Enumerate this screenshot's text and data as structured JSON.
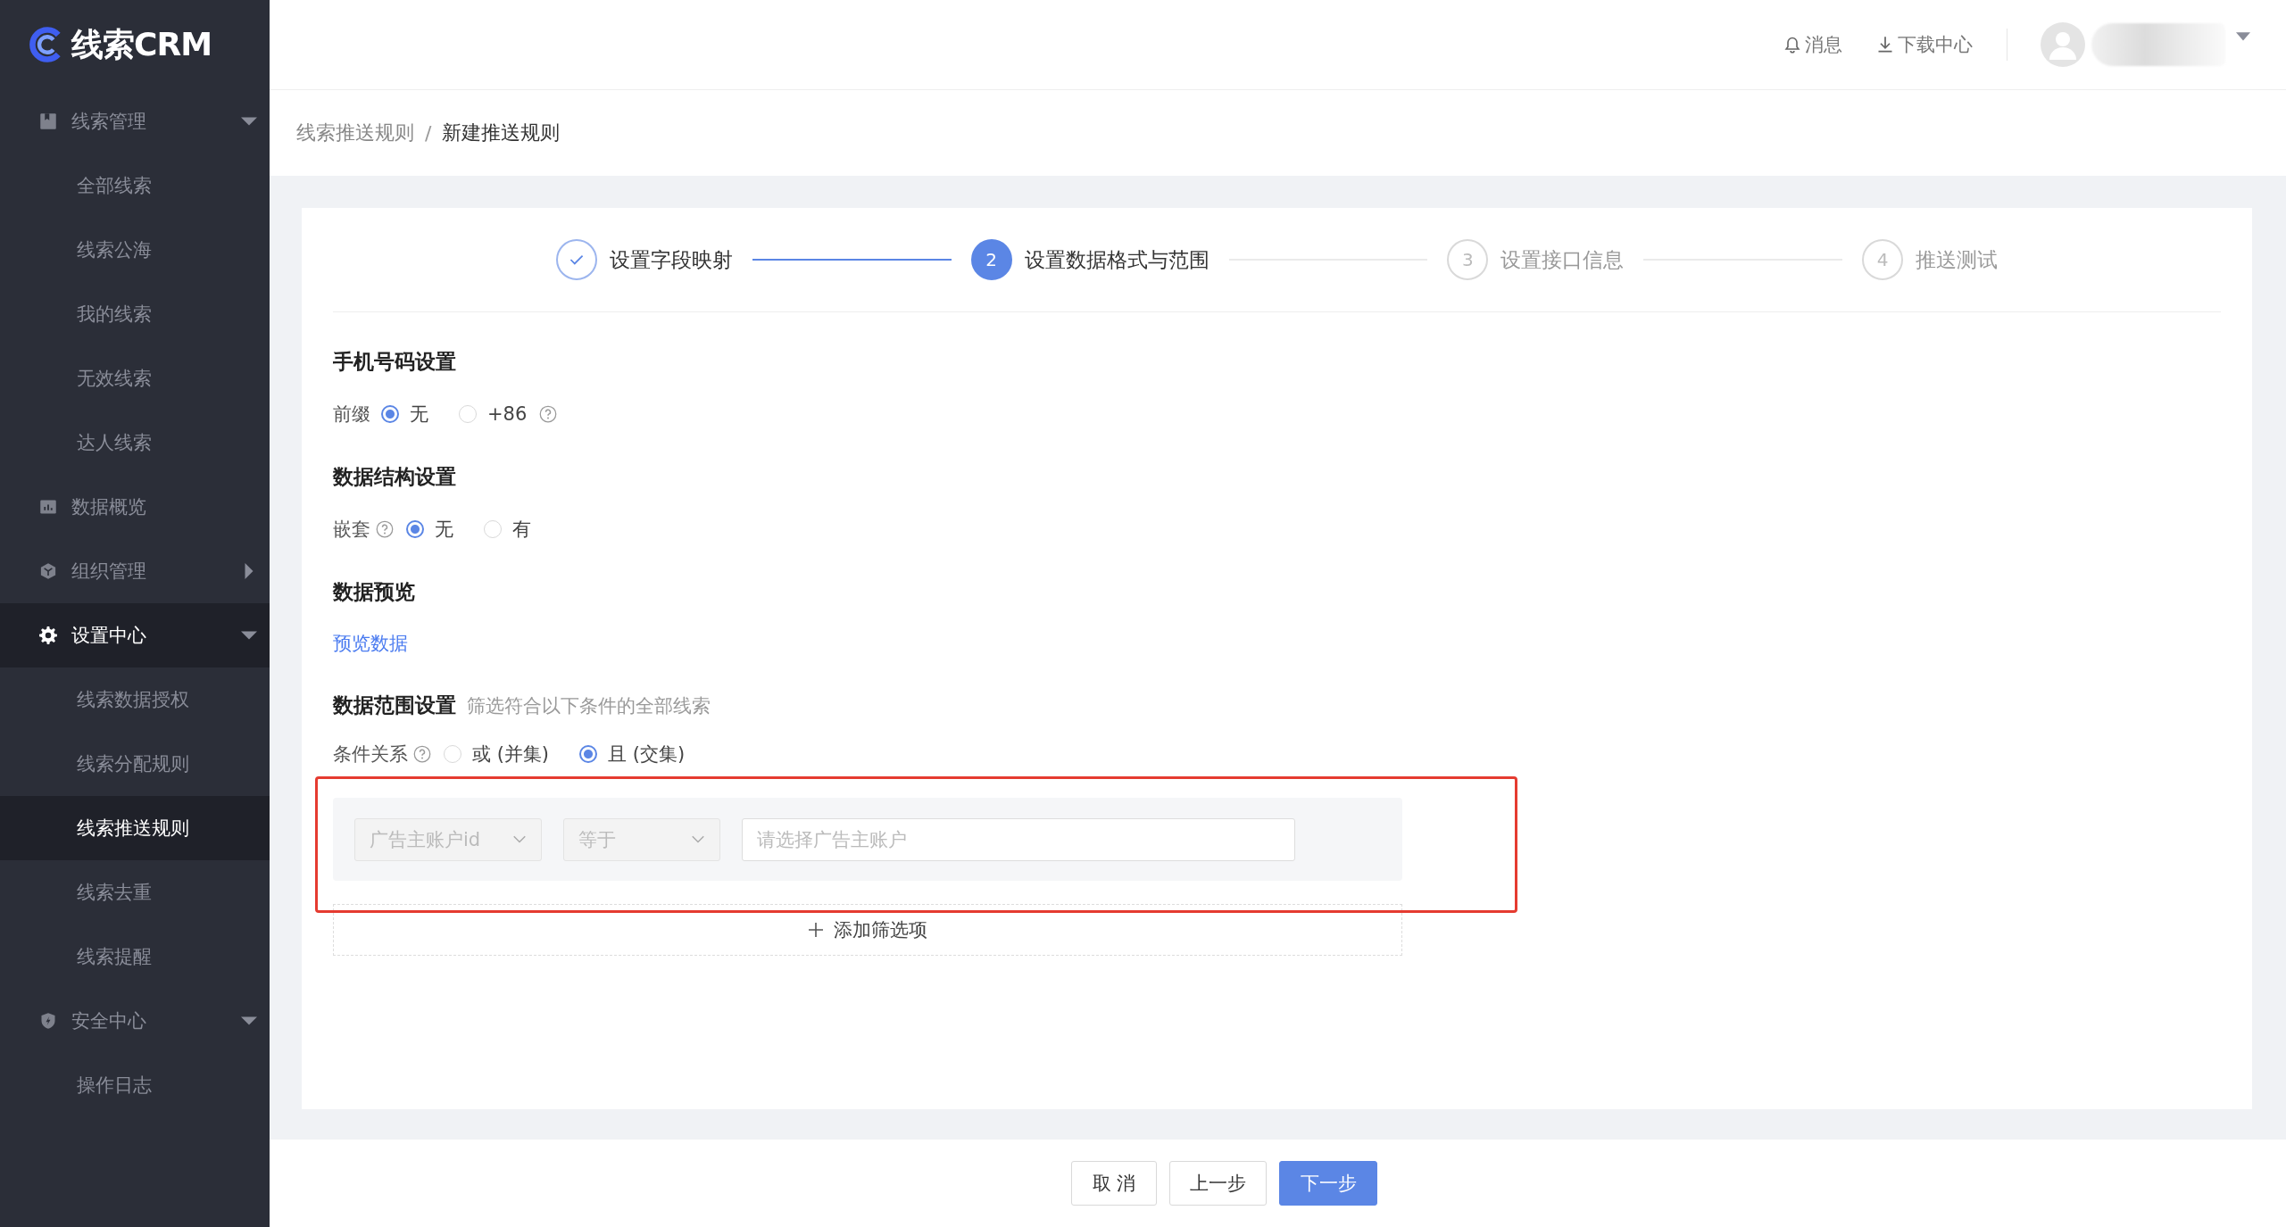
{
  "logo": {
    "text": "线索CRM"
  },
  "sidebar": {
    "items": [
      {
        "kind": "group",
        "label": "线索管理",
        "expanded": true,
        "selected": false,
        "children": [
          {
            "label": "全部线索",
            "selected": false
          },
          {
            "label": "线索公海",
            "selected": false
          },
          {
            "label": "我的线索",
            "selected": false
          },
          {
            "label": "无效线索",
            "selected": false
          },
          {
            "label": "达人线索",
            "selected": false
          }
        ]
      },
      {
        "kind": "link",
        "label": "数据概览",
        "selected": false
      },
      {
        "kind": "group",
        "label": "组织管理",
        "expanded": false,
        "selected": false
      },
      {
        "kind": "group",
        "label": "设置中心",
        "expanded": true,
        "selected": true,
        "children": [
          {
            "label": "线索数据授权",
            "selected": false
          },
          {
            "label": "线索分配规则",
            "selected": false
          },
          {
            "label": "线索推送规则",
            "selected": true
          },
          {
            "label": "线索去重",
            "selected": false
          },
          {
            "label": "线索提醒",
            "selected": false
          }
        ]
      },
      {
        "kind": "group",
        "label": "安全中心",
        "expanded": true,
        "selected": false,
        "children": [
          {
            "label": "操作日志",
            "selected": false
          }
        ]
      }
    ]
  },
  "header": {
    "messages": "消息",
    "downloads": "下载中心"
  },
  "breadcrumb": {
    "separator": "/",
    "items": [
      "线索推送规则",
      "新建推送规则"
    ]
  },
  "steps": [
    {
      "label": "设置字段映射",
      "completed": true,
      "selected": false
    },
    {
      "number": "2",
      "label": "设置数据格式与范围",
      "completed": false,
      "selected": true
    },
    {
      "number": "3",
      "label": "设置接口信息",
      "completed": false,
      "selected": false
    },
    {
      "number": "4",
      "label": "推送测试",
      "completed": false,
      "selected": false
    }
  ],
  "phone_section": {
    "title": "手机号码设置",
    "label": "前缀",
    "options": [
      {
        "label": "无",
        "selected": true
      },
      {
        "label": "+86",
        "selected": false,
        "help": true
      }
    ]
  },
  "structure_section": {
    "title": "数据结构设置",
    "label": "嵌套",
    "options": [
      {
        "label": "无",
        "selected": true
      },
      {
        "label": "有",
        "selected": false
      }
    ]
  },
  "preview_section": {
    "title": "数据预览",
    "link": "预览数据"
  },
  "range_section": {
    "title": "数据范围设置",
    "hint": "筛选符合以下条件的全部线索",
    "label": "条件关系",
    "options": [
      {
        "label": "或 (并集)",
        "selected": false
      },
      {
        "label": "且 (交集)",
        "selected": true
      }
    ],
    "filter": {
      "field": "广告主账户id",
      "operator": "等于",
      "value_placeholder": "请选择广告主账户"
    },
    "add_button": "添加筛选项"
  },
  "buttons": [
    {
      "label": "取 消",
      "kind": "default"
    },
    {
      "label": "上一步",
      "kind": "default"
    },
    {
      "label": "下一步",
      "kind": "primary"
    }
  ]
}
